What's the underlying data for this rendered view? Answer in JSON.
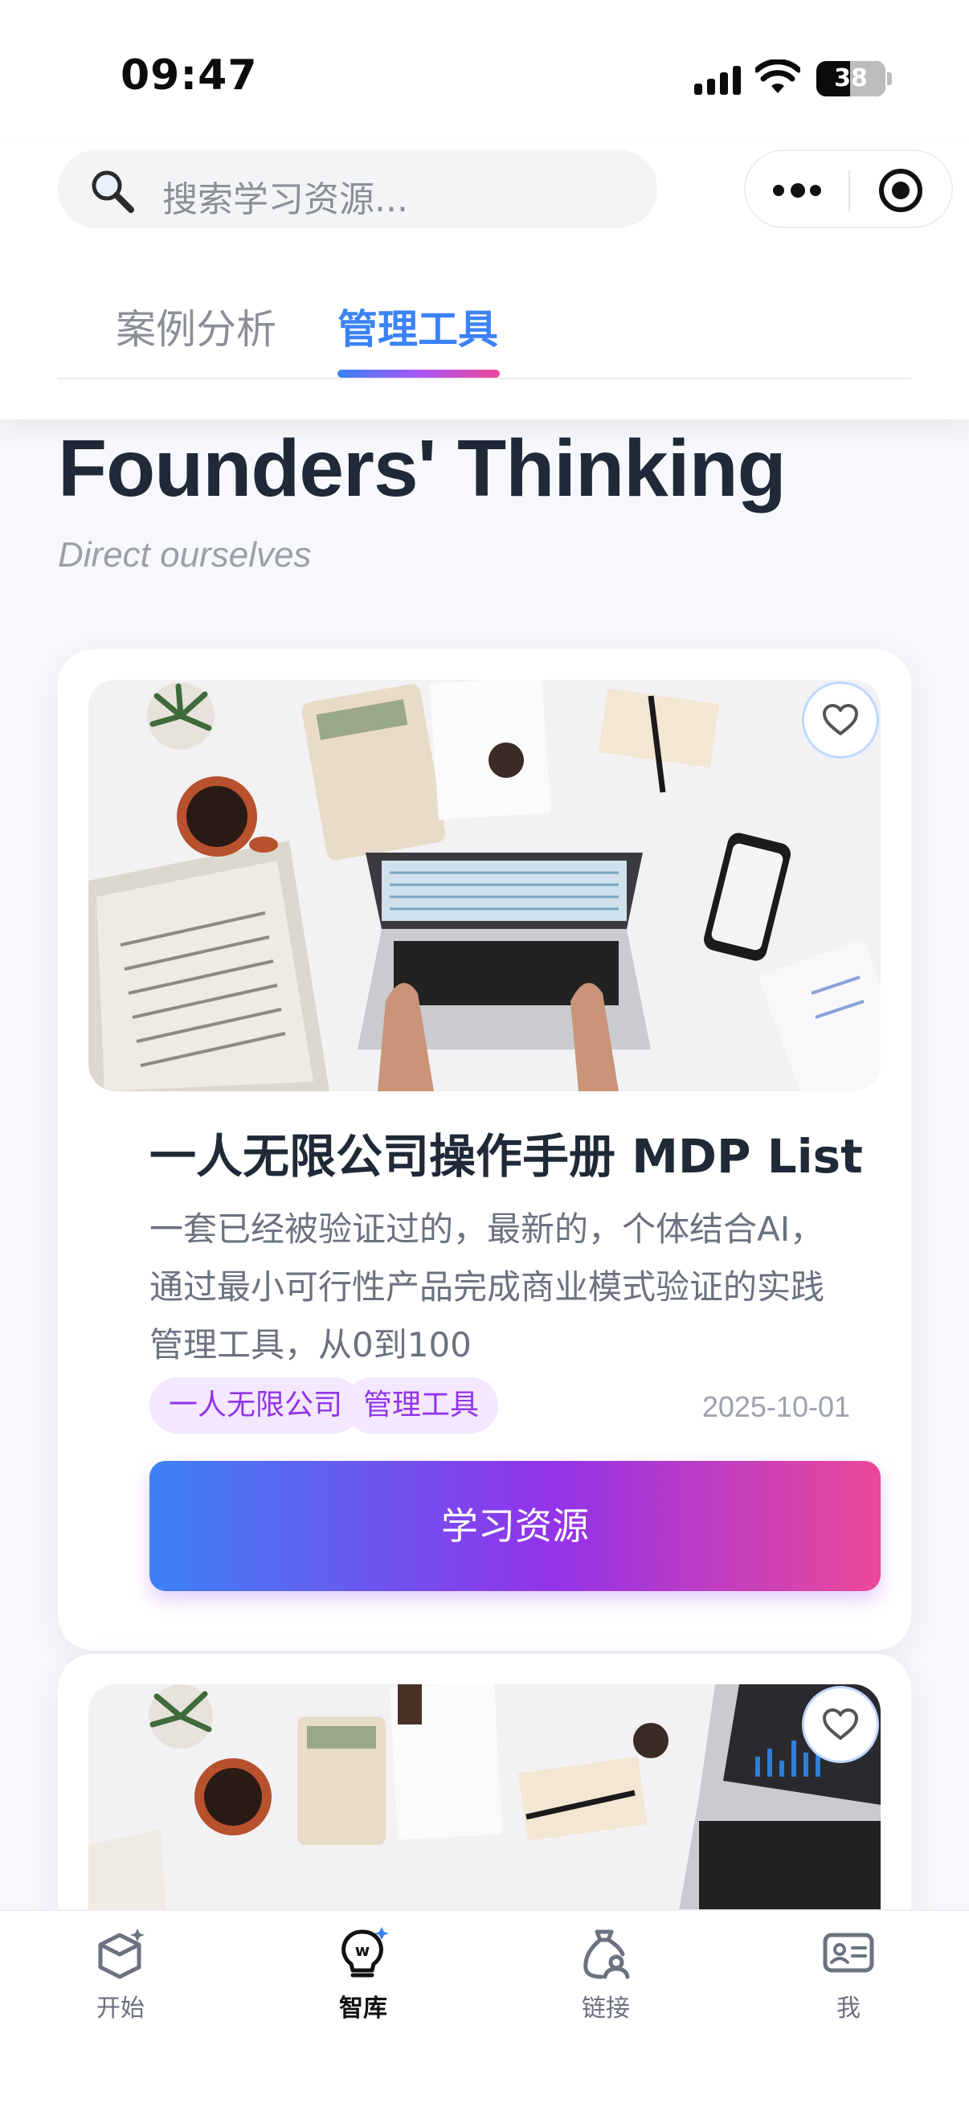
{
  "status_bar": {
    "time": "09:47",
    "battery": "38"
  },
  "search": {
    "placeholder": "搜索学习资源..."
  },
  "tabs": [
    {
      "label": "案例分析",
      "active": false
    },
    {
      "label": "管理工具",
      "active": true
    }
  ],
  "hero": {
    "title": "Founders' Thinking",
    "subtitle": "Direct ourselves"
  },
  "cards": [
    {
      "title": "一人无限公司操作手册 MDP List",
      "description_lines": [
        "一套已经被验证过的，最新的，个体结合AI，",
        "通过最小可行性产品完成商业模式验证的实践",
        "管理工具，从0到100"
      ],
      "tags": [
        "一人无限公司",
        "管理工具"
      ],
      "date": "2025-10-01",
      "cta": "学习资源",
      "favorited": false
    }
  ],
  "tabbar": [
    {
      "label": "开始",
      "icon": "box-sparkle-icon",
      "active": false
    },
    {
      "label": "智库",
      "icon": "bulb-w-icon",
      "active": true
    },
    {
      "label": "链接",
      "icon": "bag-person-icon",
      "active": false
    },
    {
      "label": "我",
      "icon": "id-card-icon",
      "active": false
    }
  ],
  "colors": {
    "accent_blue": "#3b82f6",
    "accent_purple": "#9333ea",
    "accent_pink": "#ec4899",
    "tag_bg": "#f3e8ff"
  }
}
